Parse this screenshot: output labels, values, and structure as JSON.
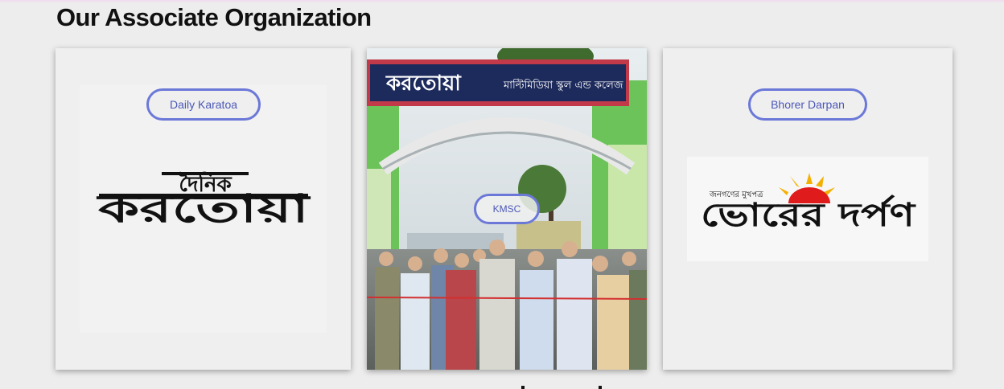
{
  "section": {
    "title": "Our Associate Organization"
  },
  "cards": [
    {
      "button_label": "Daily Karatoa",
      "logo_small_text": "দৈনিক",
      "logo_big_text": "করতোয়া"
    },
    {
      "button_label": "KMSC",
      "gate_sign_main": "করতোয়া",
      "gate_sign_sub": "মাল্টিমিডিয়া স্কুল এন্ড কলেজ"
    },
    {
      "button_label": "Bhorer Darpan",
      "logo_tagline": "জনগণের মুখপত্র",
      "logo_big_text": "ভোরের দর্পণ"
    }
  ],
  "colors": {
    "page_bg": "#ededed",
    "pill_border": "#6b78d8",
    "pill_text": "#4b57b8"
  }
}
